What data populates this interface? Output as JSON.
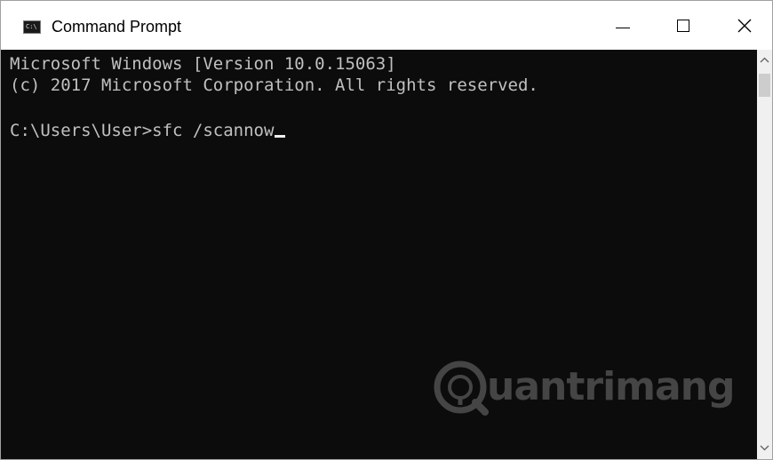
{
  "window": {
    "title": "Command Prompt",
    "icon_text": "C:\\",
    "icon": "command-prompt-icon",
    "controls": [
      "minimize-icon",
      "maximize-icon",
      "close-icon"
    ]
  },
  "console": {
    "lines": [
      "Microsoft Windows [Version 10.0.15063]",
      "(c) 2017 Microsoft Corporation. All rights reserved.",
      "",
      "C:\\Users\\User>sfc /scannow"
    ]
  },
  "watermark": {
    "text": "uantrimang",
    "icon": "quantrimang-logo-icon"
  },
  "colors": {
    "console_bg": "#0c0c0c",
    "console_text": "#c0c0c0",
    "titlebar_bg": "#ffffff"
  }
}
